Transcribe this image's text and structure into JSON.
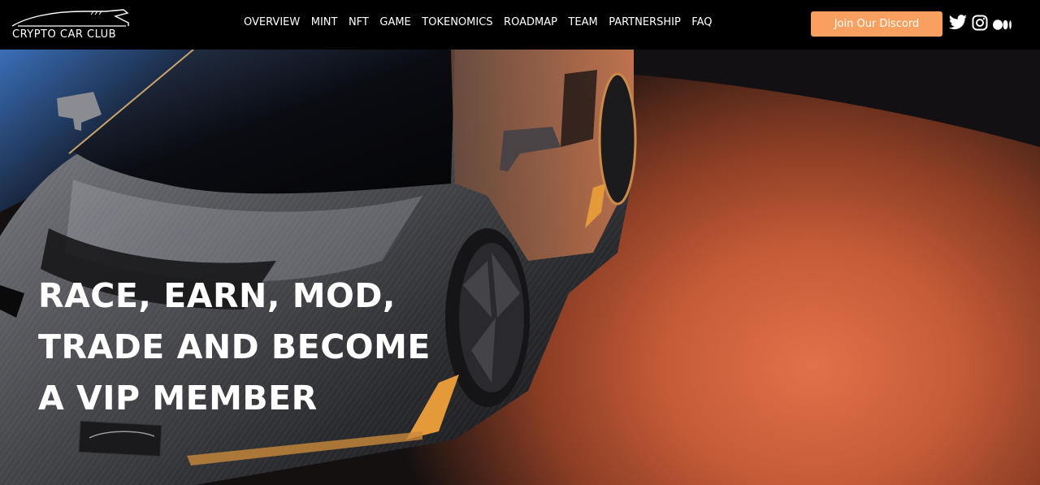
{
  "brand": {
    "name": "CRYPTO CAR CLUB"
  },
  "nav": {
    "items": [
      {
        "label": "OVERVIEW"
      },
      {
        "label": "MINT"
      },
      {
        "label": "NFT"
      },
      {
        "label": "GAME"
      },
      {
        "label": "TOKENOMICS"
      },
      {
        "label": "ROADMAP"
      },
      {
        "label": "TEAM"
      },
      {
        "label": "PARTNERSHIP"
      },
      {
        "label": "FAQ"
      }
    ]
  },
  "cta": {
    "discord_label": "Join Our Discord"
  },
  "social": {
    "icons": [
      "twitter-icon",
      "instagram-icon",
      "medium-icon"
    ]
  },
  "hero": {
    "line1": "RACE, EARN, MOD,",
    "line2": "TRADE AND BECOME",
    "line3": "A VIP MEMBER"
  },
  "colors": {
    "accent": "#f7a05f",
    "navbar_bg": "#000000",
    "floor_orange": "#e0714a"
  }
}
